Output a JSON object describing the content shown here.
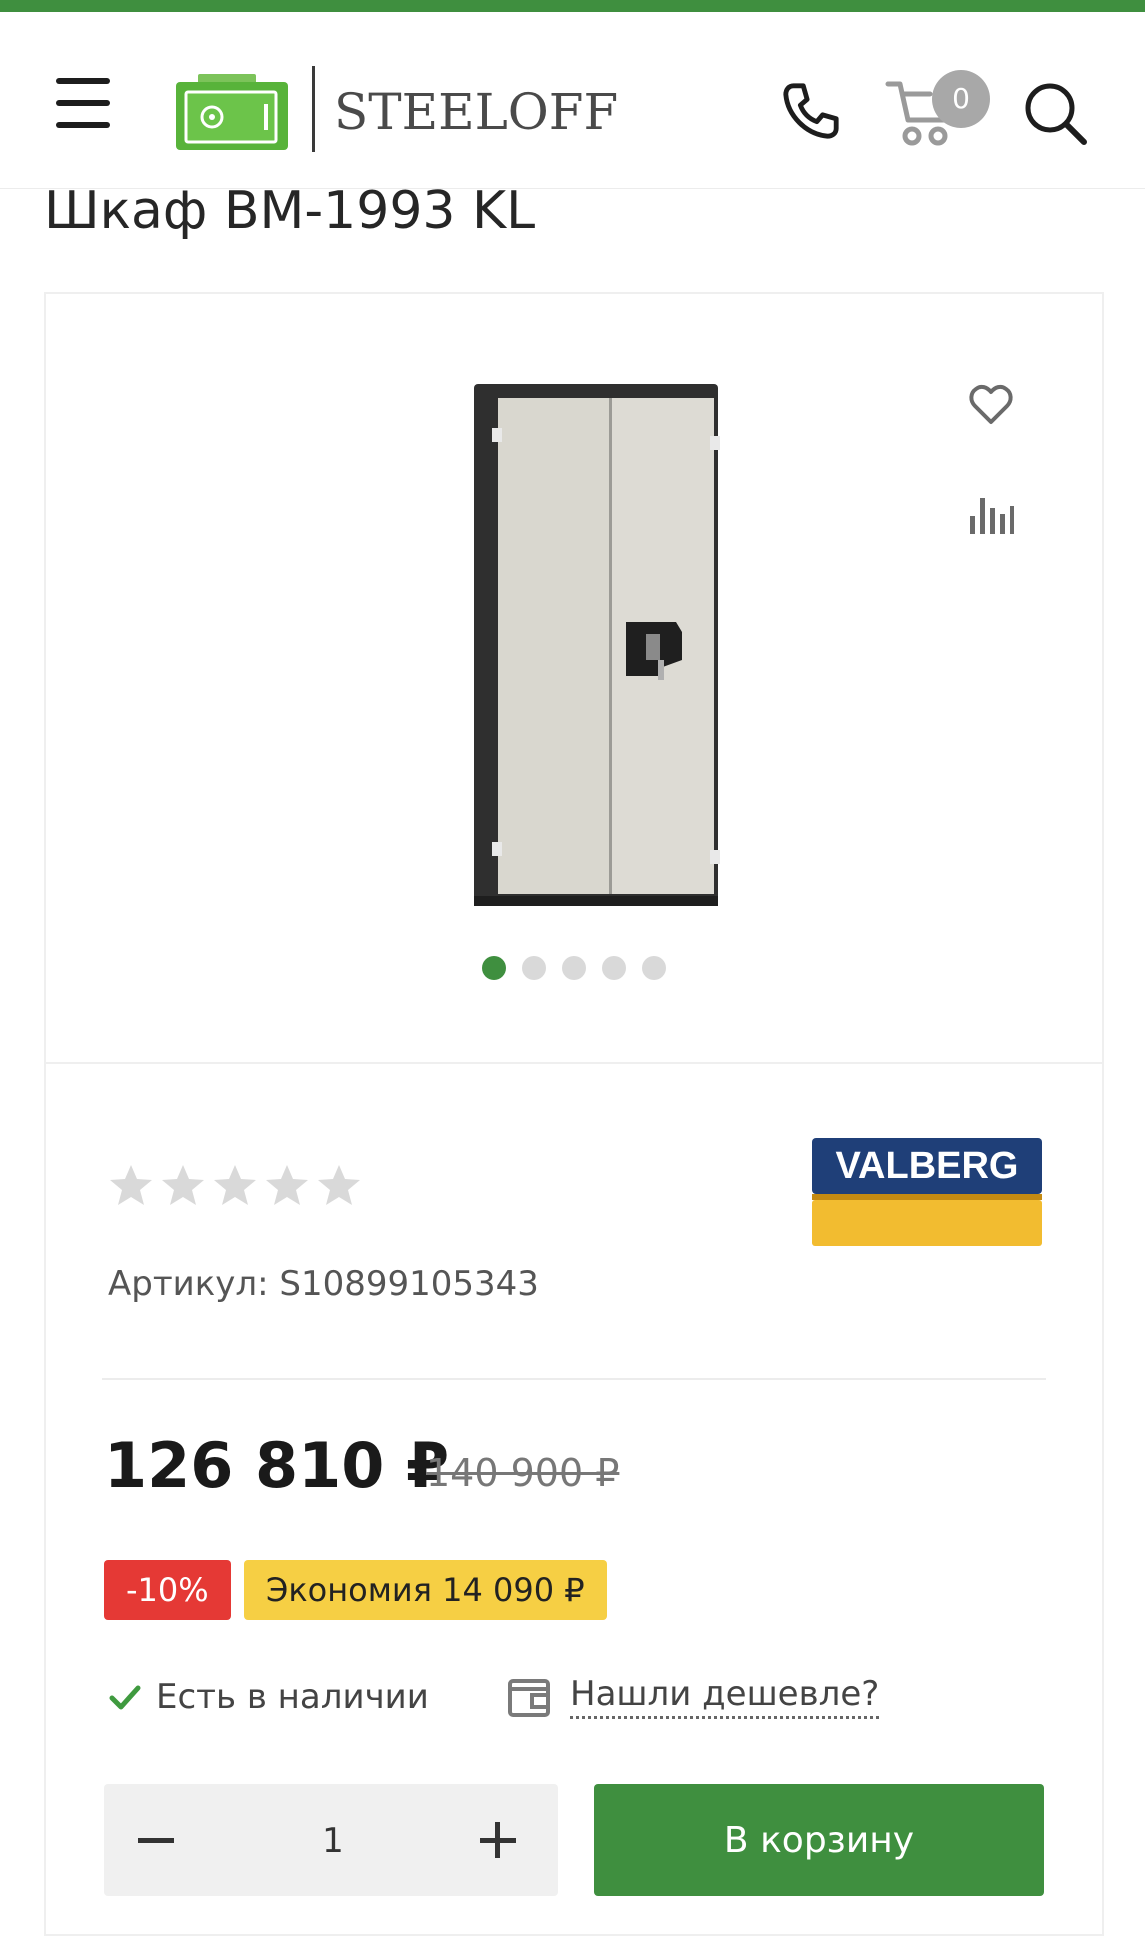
{
  "header": {
    "logo_text": "STEELOFF",
    "cart_count": "0"
  },
  "product": {
    "title": "Шкаф BM-1993 KL",
    "sku": "Артикул: S10899105343",
    "brand": "VALBERG",
    "rating": 0,
    "rating_max": 5,
    "gallery_images": 5,
    "gallery_active": 1,
    "price": "126 810 ₽",
    "old_price": "140 900 ₽",
    "discount": "-10%",
    "economy": "Экономия 14 090 ₽",
    "stock": "Есть в наличии",
    "cheaper_link": "Нашли дешевле?",
    "quantity": "1",
    "add_to_cart": "В корзину"
  },
  "colors": {
    "accent": "#3f8f3f",
    "discount": "#e53935",
    "economy": "#f6cf44",
    "cart_badge": "#a8a8a8"
  },
  "icons": [
    "menu-icon",
    "logo-safe-icon",
    "phone-icon",
    "cart-icon",
    "search-icon",
    "heart-icon",
    "compare-icon",
    "star-icon",
    "check-icon",
    "wallet-icon",
    "minus-icon",
    "plus-icon"
  ]
}
